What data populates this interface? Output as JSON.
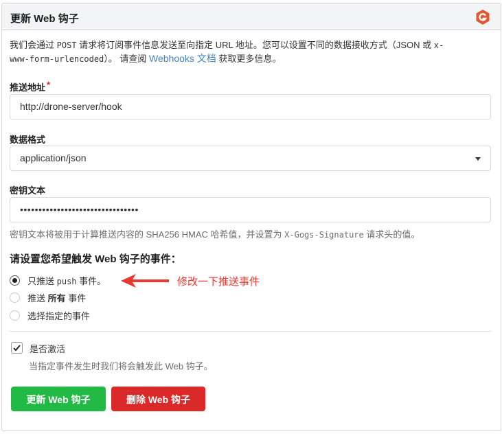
{
  "header": {
    "title": "更新 Web 钩子",
    "logo_icon": "gogs-logo-icon"
  },
  "description": {
    "part1": "我们会通过 ",
    "post": "POST",
    "part2": " 请求将订阅事件信息发送至向指定 URL 地址。您可以设置不同的数据接收方式（JSON 或 ",
    "encoded1": "x-",
    "encoded2": "www-form-urlencoded",
    "part3": "）。 请查阅 ",
    "link": "Webhooks 文档",
    "part4": " 获取更多信息。"
  },
  "payload_url": {
    "label": "推送地址",
    "required_mark": "*",
    "value": "http://drone-server/hook"
  },
  "content_type": {
    "label": "数据格式",
    "value": "application/json"
  },
  "secret": {
    "label": "密钥文本",
    "value": "••••••••••••••••••••••••••••••••",
    "help_part1": "密钥文本将被用于计算推送内容的 SHA256 HMAC 哈希值，并设置为 ",
    "help_header": "X-Gogs-Signature",
    "help_part2": " 请求头的值。"
  },
  "events": {
    "title": "请设置您希望触发 Web 钩子的事件：",
    "options": [
      {
        "pre": "只推送 ",
        "mid": "push",
        "post": " 事件。",
        "checked": true
      },
      {
        "pre": "推送 ",
        "bold": "所有",
        "post": " 事件",
        "checked": false
      },
      {
        "label": "选择指定的事件",
        "checked": false
      }
    ]
  },
  "annotation": {
    "text": "修改一下推送事件",
    "color": "#e8382f"
  },
  "active": {
    "label": "是否激活",
    "help": "当指定事件发生时我们将会触发此 Web 钩子。",
    "checked": true
  },
  "buttons": {
    "update": "更新 Web 钩子",
    "delete": "删除 Web 钩子"
  },
  "colors": {
    "green": "#21ba45",
    "red": "#db2828",
    "link": "#4183c4"
  }
}
